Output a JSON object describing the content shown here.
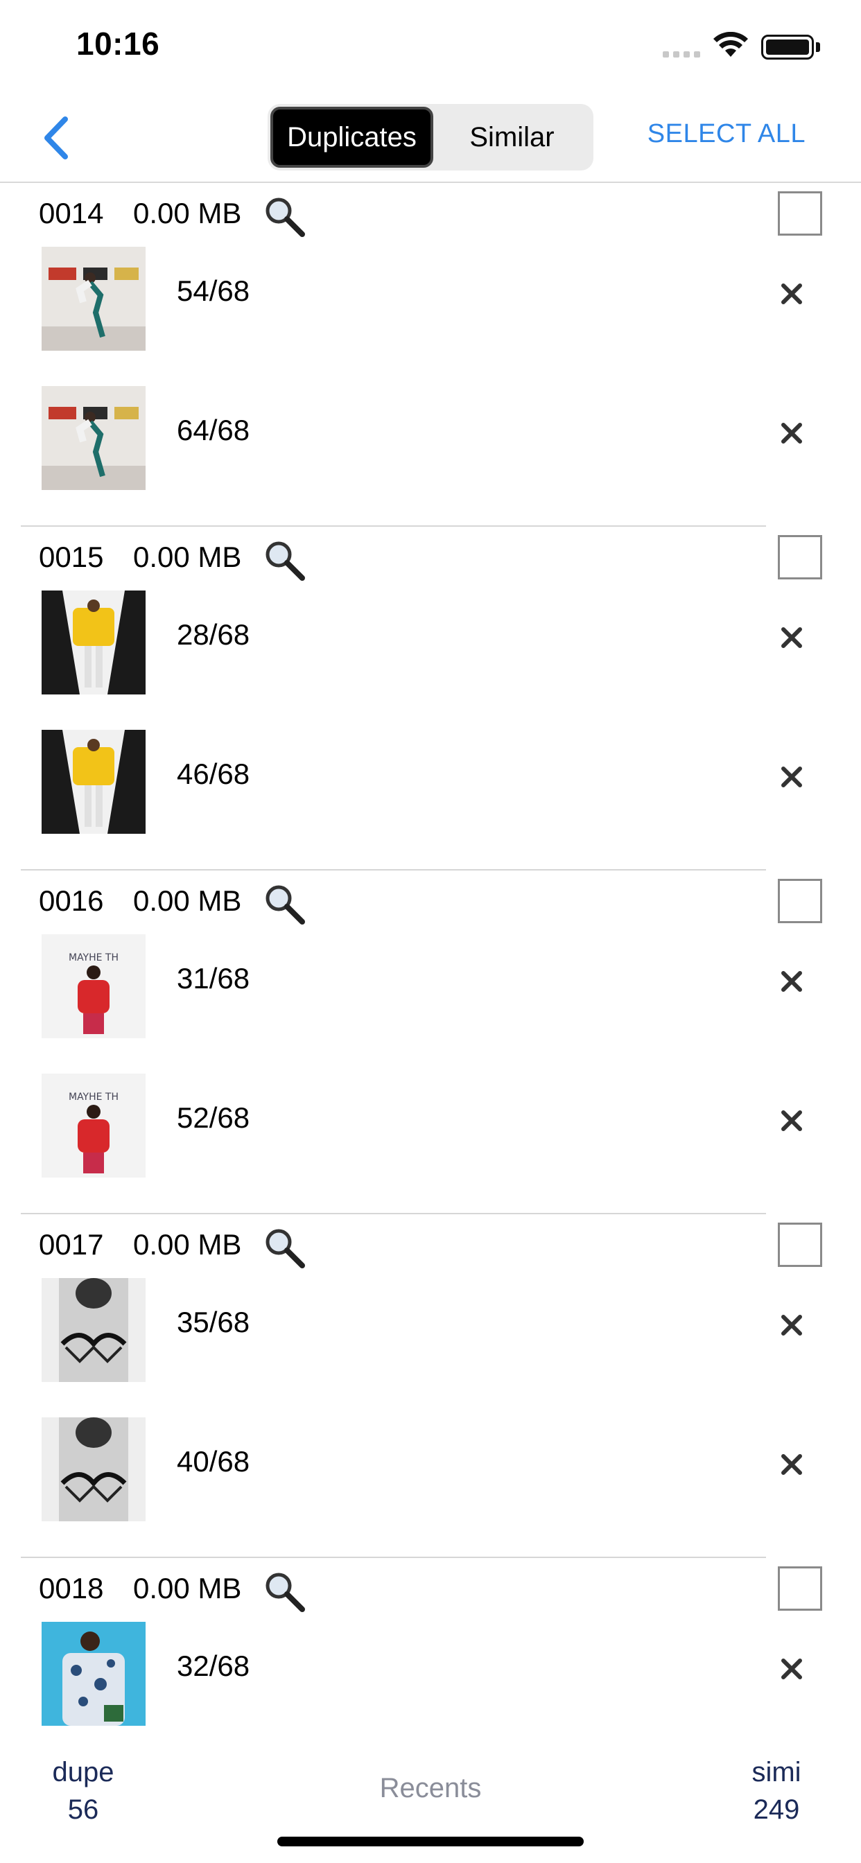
{
  "status_bar": {
    "time": "10:16"
  },
  "nav": {
    "back_icon": "chevron-left-icon",
    "tabs": [
      {
        "label": "Duplicates",
        "active": true
      },
      {
        "label": "Similar",
        "active": false
      }
    ],
    "select_all_label": "SELECT ALL",
    "accent_color": "#2f86e8"
  },
  "groups": [
    {
      "id": "0014",
      "size": "0.00 MB",
      "items": [
        {
          "count": "54/68",
          "thumb": "dancer-gallery"
        },
        {
          "count": "64/68",
          "thumb": "dancer-gallery"
        }
      ]
    },
    {
      "id": "0015",
      "size": "0.00 MB",
      "items": [
        {
          "count": "28/68",
          "thumb": "yellow-jacket"
        },
        {
          "count": "46/68",
          "thumb": "yellow-jacket"
        }
      ]
    },
    {
      "id": "0016",
      "size": "0.00 MB",
      "items": [
        {
          "count": "31/68",
          "thumb": "red-jacket"
        },
        {
          "count": "52/68",
          "thumb": "red-jacket"
        }
      ]
    },
    {
      "id": "0017",
      "size": "0.00 MB",
      "items": [
        {
          "count": "35/68",
          "thumb": "bw-lingerie"
        },
        {
          "count": "40/68",
          "thumb": "bw-lingerie"
        }
      ]
    },
    {
      "id": "0018",
      "size": "0.00 MB",
      "items": [
        {
          "count": "32/68",
          "thumb": "blue-floral"
        }
      ]
    }
  ],
  "bottom_bar": {
    "dupe_label": "dupe",
    "dupe_count": "56",
    "recents_label": "Recents",
    "simi_label": "simi",
    "simi_count": "249"
  }
}
